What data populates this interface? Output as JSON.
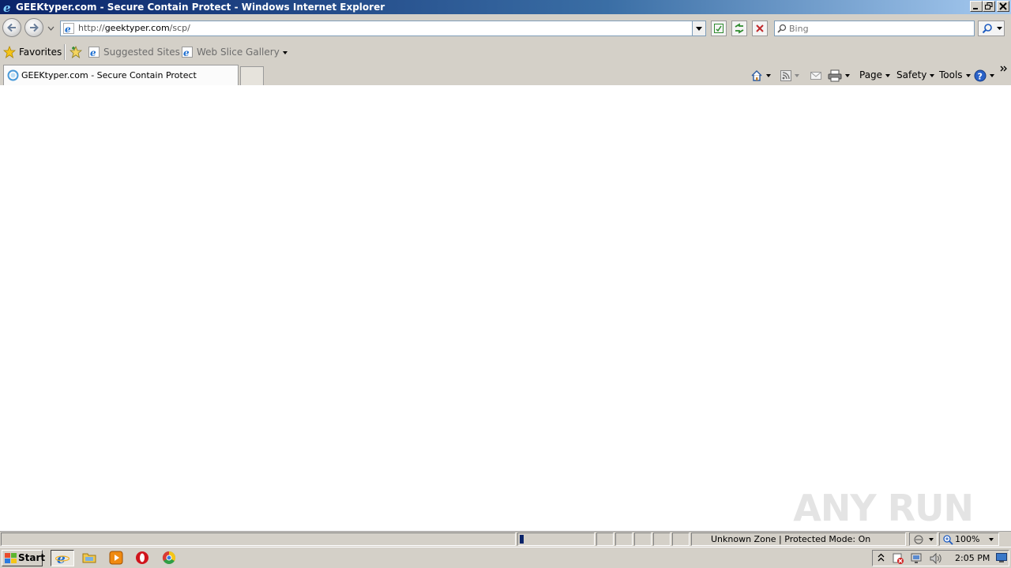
{
  "window": {
    "title": "GEEKtyper.com - Secure Contain Protect - Windows Internet Explorer"
  },
  "navigation": {
    "address": {
      "prefix": "http://",
      "domain": "geektyper.com",
      "path": "/scp/"
    },
    "search": {
      "placeholder": "Bing"
    }
  },
  "favorites_bar": {
    "favorites_label": "Favorites",
    "items": [
      {
        "label": "Suggested Sites"
      },
      {
        "label": "Web Slice Gallery"
      }
    ]
  },
  "tabs": [
    {
      "label": "GEEKtyper.com - Secure Contain Protect",
      "active": true
    }
  ],
  "command_bar": {
    "page_label": "Page",
    "safety_label": "Safety",
    "tools_label": "Tools"
  },
  "status_bar": {
    "zone_text": "Unknown Zone | Protected Mode: On",
    "zoom": "100%"
  },
  "taskbar": {
    "start_label": "Start",
    "clock": "2:05 PM"
  },
  "watermark": "ANY RUN",
  "colors": {
    "titlebar_start": "#0a246a",
    "titlebar_end": "#a6caf0",
    "chrome": "#d4d0c8",
    "content": "#ffffff"
  }
}
